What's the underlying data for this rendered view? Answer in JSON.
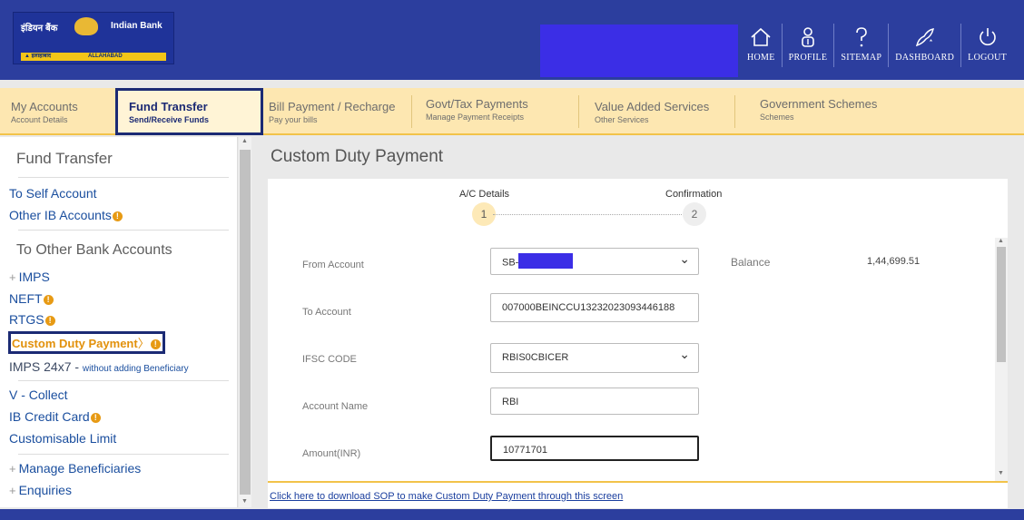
{
  "brand": {
    "hindi_name": "इंडियन बैंक",
    "english_name": "Indian Bank",
    "sub_left": "▲ इलाहाबाद",
    "sub_right": "ALLAHABAD"
  },
  "top_nav": [
    {
      "label": "HOME",
      "icon": "home-icon"
    },
    {
      "label": "PROFILE",
      "icon": "profile-icon"
    },
    {
      "label": "SITEMAP",
      "icon": "question-icon"
    },
    {
      "label": "DASHBOARD",
      "icon": "dashboard-icon"
    },
    {
      "label": "LOGOUT",
      "icon": "power-icon"
    }
  ],
  "main_menu": [
    {
      "title": "My Accounts",
      "subtitle": "Account Details"
    },
    {
      "title": "Fund Transfer",
      "subtitle": "Send/Receive Funds"
    },
    {
      "title": "Bill Payment / Recharge",
      "subtitle": "Pay your bills"
    },
    {
      "title": "Govt/Tax Payments",
      "subtitle": "Manage Payment Receipts"
    },
    {
      "title": "Value Added Services",
      "subtitle": "Other Services"
    },
    {
      "title": "Government Schemes",
      "subtitle": "Schemes"
    }
  ],
  "sidebar": {
    "heading": "Fund Transfer",
    "self_account": "To Self Account",
    "other_ib": "Other IB Accounts",
    "other_bank_heading": "To Other Bank Accounts",
    "imps": "IMPS",
    "neft": "NEFT",
    "rtgs": "RTGS",
    "custom_duty": "Custom Duty Payment",
    "imps_24x7": "IMPS 24x7 - ",
    "imps_24x7_note": "without adding Beneficiary",
    "v_collect": "V - Collect",
    "ib_credit_card": "IB Credit Card",
    "customisable_limit": "Customisable Limit",
    "manage_beneficiaries": "Manage Beneficiaries",
    "enquiries": "Enquiries"
  },
  "page": {
    "title": "Custom Duty Payment",
    "steps": [
      {
        "label": "A/C Details",
        "number": "1"
      },
      {
        "label": "Confirmation",
        "number": "2"
      }
    ],
    "from_account_label": "From Account",
    "from_account_value": "SB-",
    "balance_label": "Balance",
    "balance_value": "1,44,699.51",
    "to_account_label": "To Account",
    "to_account_value": "007000BEINCCU13232023093446188",
    "ifsc_label": "IFSC CODE",
    "ifsc_value": "RBIS0CBICER",
    "account_name_label": "Account Name",
    "account_name_value": "RBI",
    "amount_label": "Amount(INR)",
    "amount_value": "10771701",
    "sop_link": "Click here to download SOP to make Custom Duty Payment through this screen"
  },
  "colors": {
    "header_bg": "#2c3e9e",
    "menu_bg": "#fde7b1",
    "active_border": "#1b2a74",
    "link": "#1a4e9e",
    "accent": "#e2910c",
    "redaction": "#3b2ee6"
  }
}
